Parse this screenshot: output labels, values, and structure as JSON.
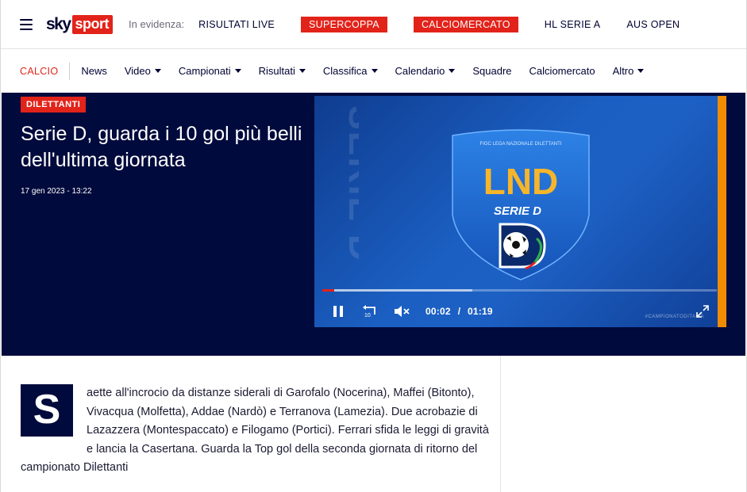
{
  "topbar": {
    "logo_sky": "sky",
    "logo_sport": "sport",
    "evidenza_label": "In evidenza:",
    "links": [
      {
        "label": "RISULTATI LIVE",
        "highlight": false
      },
      {
        "label": "SUPERCOPPA",
        "highlight": true
      },
      {
        "label": "CALCIOMERCATO",
        "highlight": true
      },
      {
        "label": "HL SERIE A",
        "highlight": false
      },
      {
        "label": "AUS OPEN",
        "highlight": false
      }
    ]
  },
  "secnav": {
    "current": "CALCIO",
    "items": [
      {
        "label": "News",
        "dropdown": false
      },
      {
        "label": "Video",
        "dropdown": true
      },
      {
        "label": "Campionati",
        "dropdown": true
      },
      {
        "label": "Risultati",
        "dropdown": true
      },
      {
        "label": "Classifica",
        "dropdown": true
      },
      {
        "label": "Calendario",
        "dropdown": true
      },
      {
        "label": "Squadre",
        "dropdown": false
      },
      {
        "label": "Calciomercato",
        "dropdown": false
      },
      {
        "label": "Altro",
        "dropdown": true
      }
    ]
  },
  "hero": {
    "badge": "DILETTANTI",
    "headline": "Serie D, guarda i 10 gol più belli dell'ultima giornata",
    "date": "17 gen 2023 - 13:22"
  },
  "video": {
    "vertical_text": "SERIE D",
    "shield_top": "FIGC LEGA NAZIONALE DILETTANTI",
    "shield_logo": "LND",
    "shield_sub": "SERIE D",
    "current_time": "00:02",
    "separator": "/",
    "duration": "01:19",
    "progress_played": 0.03,
    "progress_buffered": 0.38,
    "hashtag": "#CAMPIONATODITALIA",
    "icons": {
      "pause": "pause-icon",
      "replay": "replay-10-icon",
      "mute": "volume-muted-icon",
      "fullscreen": "fullscreen-icon"
    },
    "colors": {
      "accent": "#e2231a",
      "edge": "#f08c00"
    }
  },
  "article": {
    "dropcap": "S",
    "body": "aette all'incrocio da distanze siderali di Garofalo (Nocerina), Maffei (Bitonto), Vivacqua (Molfetta), Addae (Nardò) e Terranova (Lamezia). Due acrobazie di Lazazzera (Montespaccato) e Filogamo (Portici). Ferrari sfida le leggi di gravità e lancia la Casertana. Guarda la Top gol della seconda giornata di ritorno del campionato Dilettanti"
  },
  "colors": {
    "brand_red": "#e2231a",
    "navy": "#000a3c",
    "text_navy": "#000032"
  }
}
